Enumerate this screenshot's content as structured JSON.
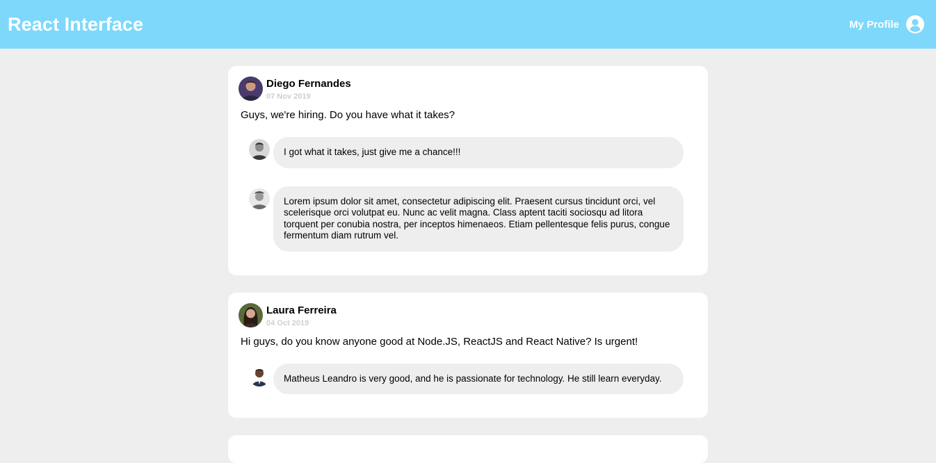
{
  "header": {
    "title": "React Interface",
    "profile_label": "My Profile"
  },
  "icons": {
    "profile": "user-circle-icon"
  },
  "colors": {
    "header_bg": "#7dd8fb",
    "page_bg": "#eeeeee",
    "bubble_bg": "#eeeeee",
    "date": "#cfcfcf"
  },
  "posts": [
    {
      "author": "Diego Fernandes",
      "date": "07 Nov 2019",
      "content": "Guys, we're hiring. Do you have what it takes?",
      "comments": [
        {
          "content": "I got what it takes, just give me a chance!!!"
        },
        {
          "content": "Lorem ipsum dolor sit amet, consectetur adipiscing elit. Praesent cursus tincidunt orci, vel scelerisque orci volutpat eu. Nunc ac velit magna. Class aptent taciti sociosqu ad litora torquent per conubia nostra, per inceptos himenaeos. Etiam pellentesque felis purus, congue fermentum diam rutrum vel."
        }
      ]
    },
    {
      "author": "Laura Ferreira",
      "date": "04 Oct 2019",
      "content": "Hi guys, do you know anyone good at Node.JS, ReactJS and React Native? Is urgent!",
      "comments": [
        {
          "content": "Matheus Leandro is very good, and he is passionate for technology. He still learn everyday."
        }
      ]
    }
  ]
}
